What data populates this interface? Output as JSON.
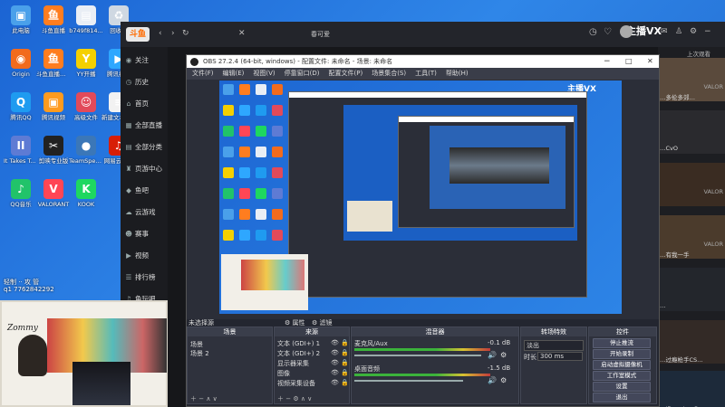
{
  "desktop": {
    "icons": [
      {
        "label": "此电脑",
        "color": "#4aa0ea",
        "glyph": "▣"
      },
      {
        "label": "斗鱼直播",
        "color": "#ff7d1f",
        "glyph": "鱼"
      },
      {
        "label": "b749f814...",
        "color": "#e9eef5",
        "glyph": "▤"
      },
      {
        "label": "回收站",
        "color": "#cfd8e2",
        "glyph": "♻"
      },
      {
        "label": "Origin",
        "color": "#f26b1d",
        "glyph": "◉"
      },
      {
        "label": "斗鱼直播伴侣",
        "color": "#ff7d1f",
        "glyph": "鱼"
      },
      {
        "label": "YY开播",
        "color": "#f5d000",
        "glyph": "Y"
      },
      {
        "label": "腾讯视频",
        "color": "#2ea7ff",
        "glyph": "▶"
      },
      {
        "label": "腾讯QQ",
        "color": "#1f9bf0",
        "glyph": "Q"
      },
      {
        "label": "腾讯视频",
        "color": "#ff9b1f",
        "glyph": "▣"
      },
      {
        "label": "高级文件",
        "color": "#e24a5a",
        "glyph": "☺"
      },
      {
        "label": "新建文本文档",
        "color": "#f2f2f2",
        "glyph": "≡"
      },
      {
        "label": "It Takes Two",
        "color": "#5e7bd4",
        "glyph": "II"
      },
      {
        "label": "剪映专业版",
        "color": "#222",
        "glyph": "✂"
      },
      {
        "label": "TeamSpeak 3",
        "color": "#3b77b8",
        "glyph": "●"
      },
      {
        "label": "网易云音乐",
        "color": "#d81e06",
        "glyph": "♫"
      },
      {
        "label": "QQ音乐",
        "color": "#21c36a",
        "glyph": "♪"
      },
      {
        "label": "VALORANT",
        "color": "#ff4655",
        "glyph": "V"
      },
      {
        "label": "KOOK",
        "color": "#1ed760",
        "glyph": "K"
      }
    ],
    "overlay_text_1": "轻制 ·· 攻 管",
    "overlay_text_2": "q1 7762842292"
  },
  "douyu": {
    "logo": "斗鱼",
    "nav_back": "‹",
    "nav_forward": "›",
    "nav_refresh": "↻",
    "address": "春可爱",
    "close_tab": "✕",
    "right_brand": "主播VX",
    "sidebar": [
      {
        "icon": "◉",
        "label": "关注"
      },
      {
        "icon": "◷",
        "label": "历史"
      },
      {
        "icon": "⌂",
        "label": "首页"
      },
      {
        "icon": "▦",
        "label": "全部直播"
      },
      {
        "icon": "▤",
        "label": "全部分类"
      },
      {
        "icon": "♜",
        "label": "页游中心"
      },
      {
        "icon": "◆",
        "label": "鱼吧"
      },
      {
        "icon": "☁",
        "label": "云游戏"
      },
      {
        "icon": "☻",
        "label": "赛事"
      },
      {
        "icon": "▶",
        "label": "视频"
      },
      {
        "icon": "☰",
        "label": "排行榜"
      },
      {
        "icon": "♫",
        "label": "鱼玩吧"
      }
    ],
    "right_top_label": "上次观看",
    "thumbs": [
      {
        "caption": "…多伦多郊…",
        "tag": "VALOR"
      },
      {
        "caption": "…CvO",
        "tag": ""
      },
      {
        "caption": "",
        "tag": "VALOR"
      },
      {
        "caption": "…有我一手",
        "tag": "VALOR"
      },
      {
        "caption": "…",
        "tag": ""
      },
      {
        "caption": "…过瘾枪手CS…",
        "tag": ""
      },
      {
        "caption": "…JDongLaoGen",
        "tag": ""
      }
    ]
  },
  "obs": {
    "title": "OBS 27.2.4 (64-bit, windows) - 配置文件: 未命名 - 场景: 未命名",
    "menu": [
      "文件(F)",
      "编辑(E)",
      "视图(V)",
      "停靠窗口(D)",
      "配置文件(P)",
      "场景集合(S)",
      "工具(T)",
      "帮助(H)"
    ],
    "source_selected": "未选择源",
    "props_btn": "⚙ 属性",
    "filter_btn": "⚙ 滤镜",
    "panels": {
      "scenes": {
        "title": "场景",
        "items": [
          "场景",
          "场景 2"
        ]
      },
      "sources": {
        "title": "来源",
        "items": [
          "文本 (GDI+) 1",
          "文本 (GDI+) 2",
          "显示器采集",
          "图像",
          "视频采集设备"
        ]
      },
      "mixer": {
        "title": "混音器",
        "track1": "麦克风/Aux",
        "track1_db": "-0.1 dB",
        "track2": "桌面音频",
        "track2_db": "-1.5 dB"
      },
      "transitions": {
        "title": "转场特效",
        "type": "淡出",
        "duration_label": "时长",
        "duration": "300 ms"
      },
      "controls": {
        "title": "控件",
        "buttons": [
          "停止推流",
          "开始录制",
          "启动虚拟摄像机",
          "工作室模式",
          "设置",
          "退出"
        ]
      }
    }
  },
  "cam": {
    "name": "Zommy"
  }
}
